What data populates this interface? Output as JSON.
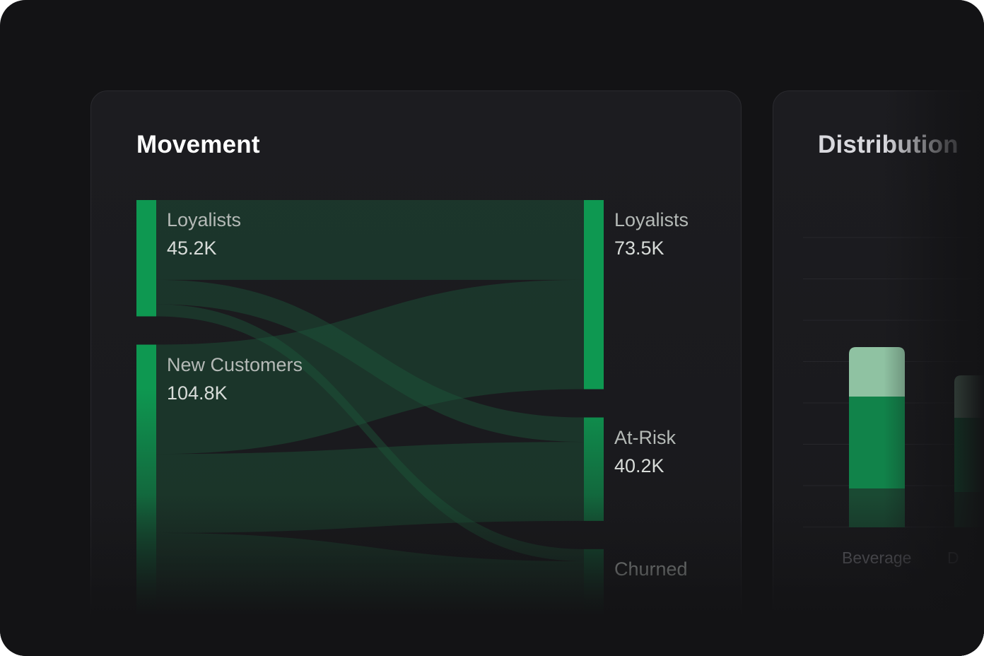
{
  "cards": {
    "movement_title": "Movement",
    "distribution_title": "Distribution"
  },
  "chart_data": [
    {
      "type": "sankey",
      "title": "Movement",
      "sources": [
        {
          "name": "Loyalists",
          "value_label": "45.2K"
        },
        {
          "name": "New Customers",
          "value_label": "104.8K"
        }
      ],
      "targets": [
        {
          "name": "Loyalists",
          "value_label": "73.5K"
        },
        {
          "name": "At-Risk",
          "value_label": "40.2K"
        },
        {
          "name": "Churned",
          "value_label": ""
        }
      ],
      "links": [
        {
          "source": 0,
          "target": 0,
          "value": 31
        },
        {
          "source": 0,
          "target": 1,
          "value": 9.5
        },
        {
          "source": 0,
          "target": 2,
          "value": 4.7
        },
        {
          "source": 1,
          "target": 0,
          "value": 42.5
        },
        {
          "source": 1,
          "target": 1,
          "value": 30.7
        },
        {
          "source": 1,
          "target": 2,
          "value": 31.6
        }
      ],
      "colors": {
        "node": "#0e9851",
        "link": "#1d5a3c"
      }
    },
    {
      "type": "bar",
      "title": "Distribution",
      "categories": [
        "Beverage",
        "D"
      ],
      "series": [
        {
          "values": [
            55,
            50
          ],
          "color": "#1a4a33"
        },
        {
          "values": [
            130,
            105
          ],
          "color": "#11834a"
        },
        {
          "values": [
            70,
            60
          ],
          "color": "#8fc2a2"
        }
      ]
    }
  ]
}
